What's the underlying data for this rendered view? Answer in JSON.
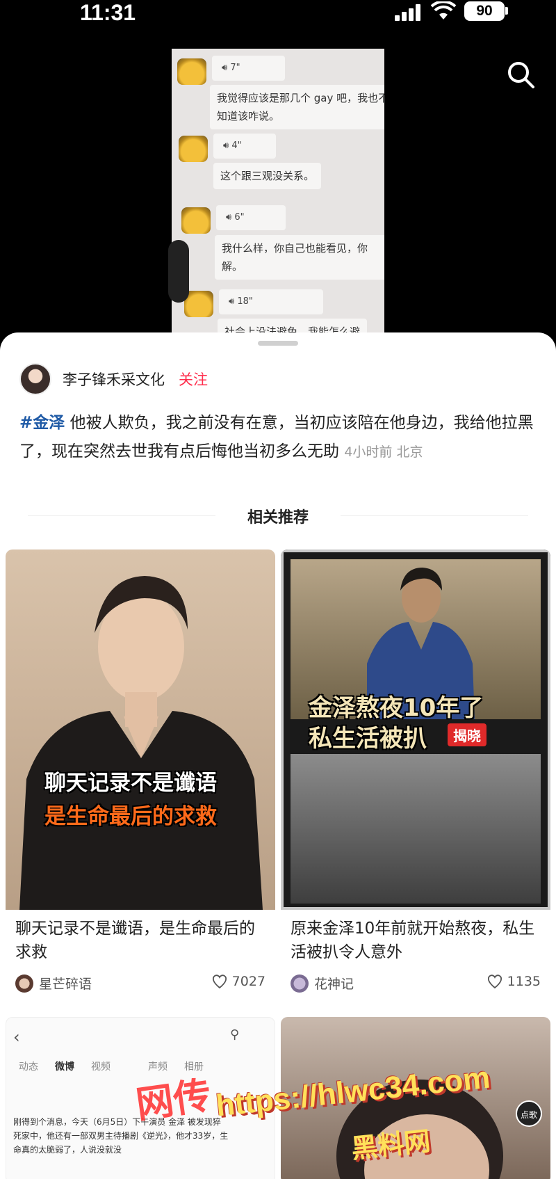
{
  "status_bar": {
    "time": "11:31",
    "battery": "90"
  },
  "chat": {
    "messages": [
      {
        "voice": "7\"",
        "text_lines": [
          "我觉得应该是那几个 gay 吧，我也不",
          "知道该咋说。"
        ]
      },
      {
        "voice": "4\"",
        "text_lines": [
          "这个跟三观没关系。"
        ]
      },
      {
        "voice": "6\"",
        "text_lines": [
          "我什么样，你自己也能看见，你",
          "解。"
        ]
      },
      {
        "voice": "18\"",
        "text_lines": [
          "社会上没法避免，我能怎么避"
        ]
      }
    ]
  },
  "post": {
    "author": "李子锋禾采文化",
    "follow_label": "关注",
    "hashtag": "#金泽",
    "body": " 他被人欺负，我之前没有在意，当初应该陪在他身边，我给他拉黑了，现在突然去世我有点后悔他当初多么无助",
    "meta": "4小时前 北京"
  },
  "related": {
    "header": "相关推荐",
    "cards": [
      {
        "overlay_line1": "聊天记录不是谶语",
        "overlay_line2": "是生命最后的求救",
        "title": "聊天记录不是谶语，是生命最后的求救",
        "user": "星芒碎语",
        "likes": "7027"
      },
      {
        "overlay_line1": "金泽熬夜10年了",
        "overlay_line2": "私生活被扒",
        "overlay_badge": "揭晓",
        "title": "原来金泽10年前就开始熬夜，私生活被扒令人意外",
        "user": "花神记",
        "likes": "1135"
      },
      {
        "nav_tabs": [
          "动态",
          "微博",
          "视频",
          "声频",
          "相册"
        ],
        "preview_text": "刚得到个消息，今天（6月5日）下午演员 金泽 被发现猝死家中，他还有一部双男主待播剧《逆光》，他才33岁，生命真的太脆弱了，人说没就没",
        "stamp": "网传"
      },
      {
        "badge": "点歌"
      }
    ]
  },
  "watermark": {
    "url": "https://hlwc34.com",
    "name": "黑料网"
  }
}
